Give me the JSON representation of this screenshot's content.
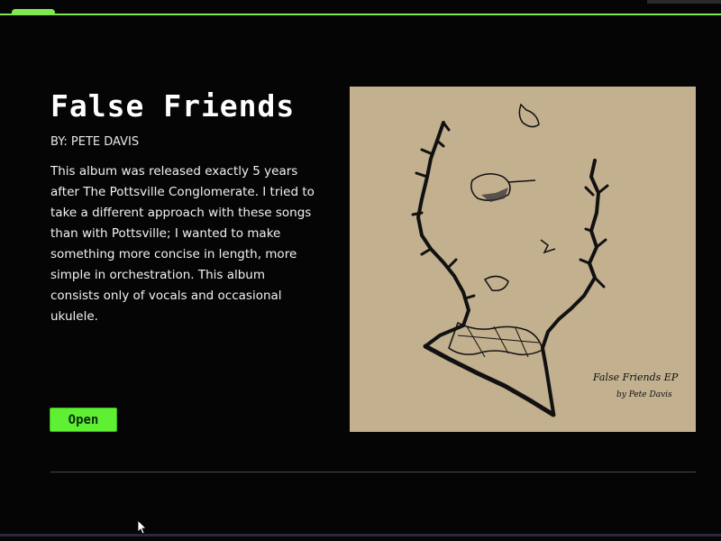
{
  "album": {
    "title": "False Friends",
    "byline": "BY: PETE DAVIS",
    "description": "This album was released exactly 5 years after The Pottsville Conglomerate. I tried to take a different approach with these songs than with Pottsville; I wanted to make something more concise in length, more simple in orchestration. This album consists only of vocals and occasional ukulele."
  },
  "actions": {
    "open_label": "Open"
  },
  "cover": {
    "handwriting_line1": "False Friends EP",
    "handwriting_line2": "by Pete Davis"
  },
  "colors": {
    "accent": "#7ee84e",
    "button": "#5ff034",
    "background": "#050505",
    "cover_paper": "#c2b08f"
  }
}
